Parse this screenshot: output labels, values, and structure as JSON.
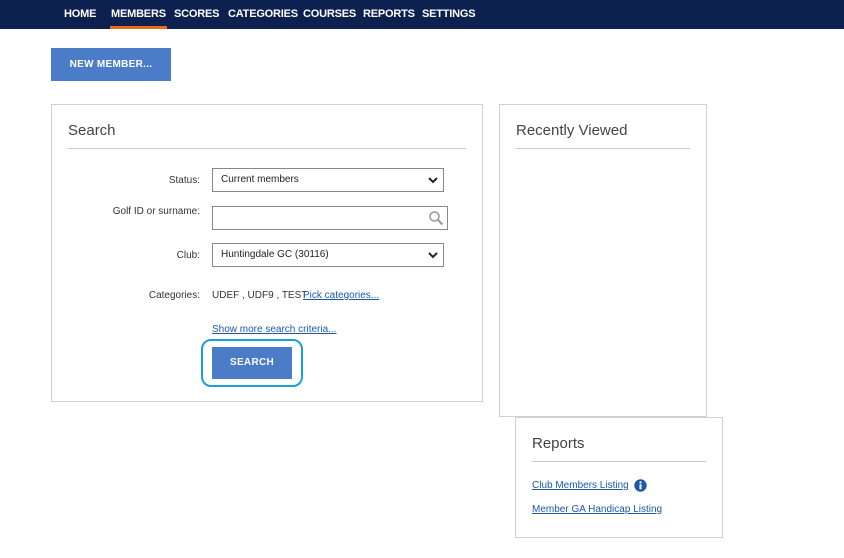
{
  "nav": {
    "items": [
      {
        "label": "HOME"
      },
      {
        "label": "MEMBERS"
      },
      {
        "label": "SCORES"
      },
      {
        "label": "CATEGORIES"
      },
      {
        "label": "COURSES"
      },
      {
        "label": "REPORTS"
      },
      {
        "label": "SETTINGS"
      }
    ],
    "active": "MEMBERS"
  },
  "new_member_button": "NEW MEMBER...",
  "search": {
    "title": "Search",
    "status_label": "Status:",
    "status_value": "Current members",
    "golf_id_label": "Golf ID or surname:",
    "golf_id_value": "",
    "club_label": "Club:",
    "club_value": "Huntingdale GC (30116)",
    "categories_label": "Categories:",
    "categories_value": "UDEF , UDF9 , TEST",
    "pick_categories_link": "Pick categories...",
    "show_more_link": "Show more search criteria...",
    "search_button": "SEARCH"
  },
  "recently_viewed": {
    "title": "Recently Viewed"
  },
  "reports": {
    "title": "Reports",
    "links": [
      {
        "label": "Club Members Listing",
        "has_info_icon": true
      },
      {
        "label": "Member GA Handicap Listing",
        "has_info_icon": false
      }
    ]
  },
  "colors": {
    "nav_bg": "#0d2150",
    "nav_active_underline": "#e86a1c",
    "button_bg": "#4a7cc7",
    "link": "#1a5aa8",
    "focus_ring": "#1aa0d6",
    "info_icon": "#1a5aa8"
  }
}
